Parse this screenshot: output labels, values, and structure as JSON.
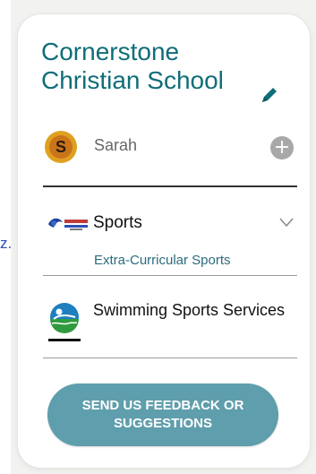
{
  "left_fragment": "z.",
  "school": {
    "name": "Cornerstone Christian School",
    "edit_icon": "pencil-icon"
  },
  "user": {
    "name": "Sarah",
    "avatar_letter": "S",
    "add_icon": "plus-circle-icon",
    "add_symbol": "+"
  },
  "menu": {
    "sports": {
      "label": "Sports",
      "logo": "sports-logo",
      "expand_icon": "chevron-down-icon",
      "subitems": [
        "Extra-Curricular Sports"
      ]
    },
    "swimming": {
      "label": "Swimming Sports Services",
      "logo": "swim-logo"
    }
  },
  "feedback": {
    "label": "SEND US FEEDBACK OR SUGGESTIONS"
  },
  "colors": {
    "title": "#0f6e78",
    "button": "#5f9eac",
    "subitem": "#2b6b7d"
  }
}
